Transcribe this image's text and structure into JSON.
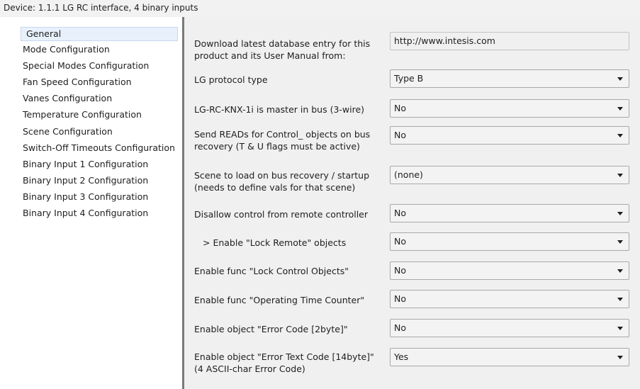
{
  "window": {
    "title": "Device: 1.1.1  LG RC interface, 4 binary inputs"
  },
  "sidebar": {
    "items": [
      {
        "label": "General"
      },
      {
        "label": "Mode Configuration"
      },
      {
        "label": "Special Modes Configuration"
      },
      {
        "label": "Fan Speed Configuration"
      },
      {
        "label": "Vanes Configuration"
      },
      {
        "label": "Temperature Configuration"
      },
      {
        "label": "Scene Configuration"
      },
      {
        "label": "Switch-Off Timeouts Configuration"
      },
      {
        "label": "Binary Input 1 Configuration"
      },
      {
        "label": "Binary Input 2 Configuration"
      },
      {
        "label": "Binary Input 3 Configuration"
      },
      {
        "label": "Binary Input 4 Configuration"
      }
    ]
  },
  "params": [
    {
      "label": "Download latest database entry for this product and its User Manual from:",
      "value": "http://www.intesis.com"
    },
    {
      "label": "LG protocol type",
      "value": "Type B"
    },
    {
      "label": "LG-RC-KNX-1i is master in bus (3-wire)",
      "value": "No"
    },
    {
      "label": "Send READs for Control_ objects on bus recovery (T & U flags must be active)",
      "value": "No"
    },
    {
      "label": "Scene to load on bus recovery / startup (needs to define vals for that scene)",
      "value": "(none)"
    },
    {
      "label": "Disallow control from remote controller",
      "value": "No"
    },
    {
      "label": "> Enable \"Lock Remote\" objects",
      "value": "No"
    },
    {
      "label": "Enable func \"Lock Control Objects\"",
      "value": "No"
    },
    {
      "label": "Enable func \"Operating Time Counter\"",
      "value": "No"
    },
    {
      "label": "Enable object \"Error Code [2byte]\"",
      "value": "No"
    },
    {
      "label": "Enable object \"Error Text Code [14byte]\" (4 ASCII-char Error Code)",
      "value": "Yes"
    }
  ]
}
